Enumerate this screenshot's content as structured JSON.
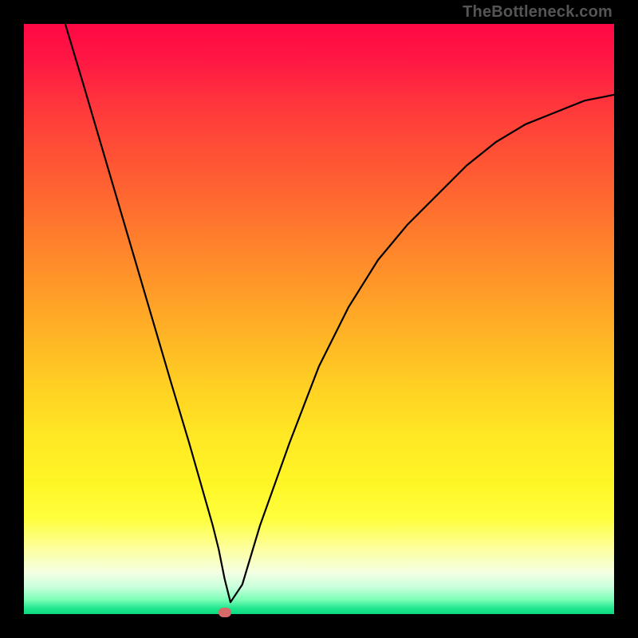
{
  "attribution_text": "TheBottleneck.com",
  "colors": {
    "curve": "#000000",
    "marker": "#d56a68",
    "frame": "#000000"
  },
  "chart_data": {
    "type": "line",
    "title": "",
    "xlabel": "",
    "ylabel": "",
    "xlim": [
      0,
      100
    ],
    "ylim": [
      0,
      100
    ],
    "series": [
      {
        "name": "bottleneck-curve",
        "x": [
          7,
          10,
          15,
          20,
          25,
          28,
          30,
          32,
          33,
          34,
          35,
          37,
          40,
          45,
          50,
          55,
          60,
          65,
          70,
          75,
          80,
          85,
          90,
          95,
          100
        ],
        "values": [
          100,
          90,
          73,
          56,
          39,
          29,
          22,
          15,
          11,
          6,
          2,
          5,
          15,
          29,
          42,
          52,
          60,
          66,
          71,
          76,
          80,
          83,
          85,
          87,
          88
        ]
      }
    ],
    "min_point": {
      "x": 34,
      "y": 0
    }
  }
}
